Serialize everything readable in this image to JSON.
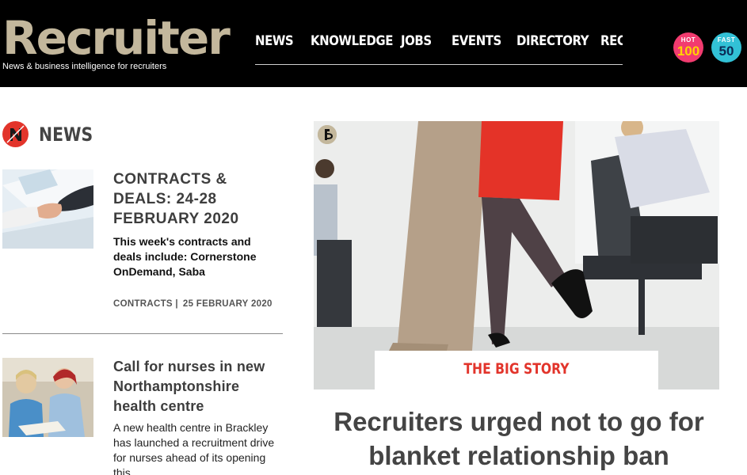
{
  "header": {
    "logo": "Recruiter",
    "tagline": "News & business intelligence for recruiters",
    "nav": [
      "NEWS",
      "KNOWLEDGE",
      "JOBS",
      "EVENTS",
      "DIRECTORY",
      "REC"
    ],
    "badges": [
      {
        "top": "HOT",
        "bottom": "100"
      },
      {
        "top": "FAST",
        "bottom": "50"
      }
    ]
  },
  "section": {
    "title": "NEWS"
  },
  "articles": [
    {
      "title": "CONTRACTS & DEALS: 24-28 FEBRUARY 2020",
      "summary": "This week's contracts and deals include: Cornerstone OnDemand, Saba",
      "category": "CONTRACTS |",
      "date": "25 FEBRUARY 2020"
    },
    {
      "title": "Call for nurses in new Northamptonshire health centre",
      "summary": "A new health centre in Brackley has launched a recruitment drive for nurses ahead of its opening this"
    }
  ],
  "big_story": {
    "label": "THE BIG STORY",
    "headline": "Recruiters urged not to go for blanket relationship ban"
  },
  "colors": {
    "brand_gold": "#c3b79c",
    "accent_red": "#e2342b",
    "hot_pink": "#f23b6f",
    "fast_teal": "#32c1d6"
  }
}
